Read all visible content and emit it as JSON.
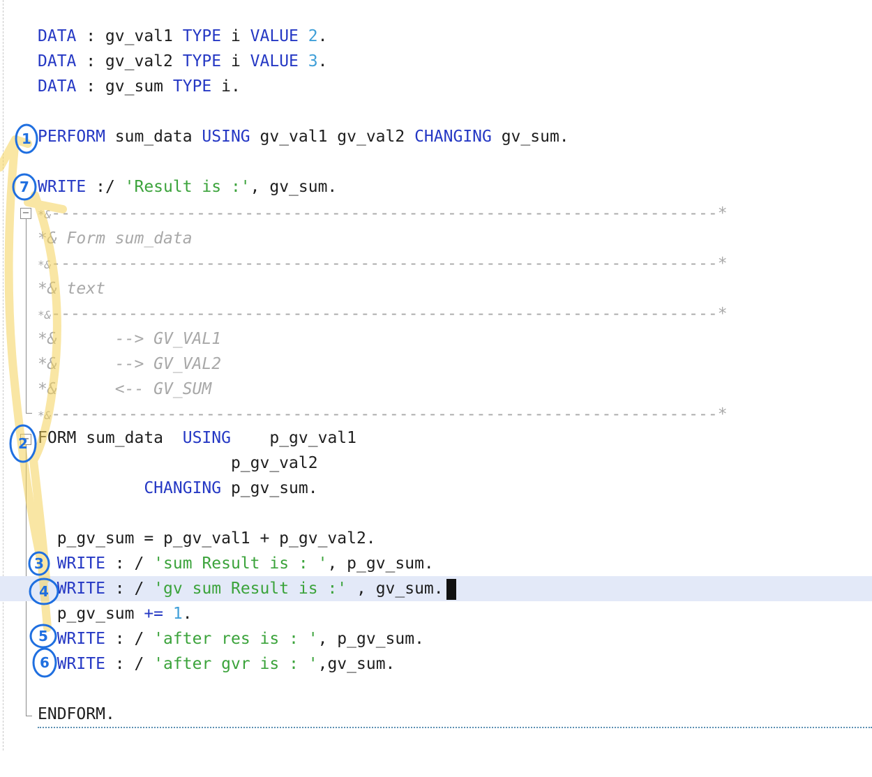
{
  "code": {
    "l1": {
      "kw1": "DATA",
      "p1": " : gv_val1 ",
      "kw2": "TYPE",
      "p2": " i ",
      "kw3": "VALUE",
      "sp": " ",
      "num": "2",
      "end": "."
    },
    "l2": {
      "kw1": "DATA",
      "p1": " : gv_val2 ",
      "kw2": "TYPE",
      "p2": " i ",
      "kw3": "VALUE",
      "sp": " ",
      "num": "3",
      "end": "."
    },
    "l3": {
      "kw1": "DATA",
      "p1": " : gv_sum ",
      "kw2": "TYPE",
      "p2": " i."
    },
    "l4": {
      "kw1": "PERFORM",
      "p1": " sum_data ",
      "kw2": "USING",
      "p2": " gv_val1 gv_val2 ",
      "kw3": "CHANGING",
      "p3": " gv_sum."
    },
    "l5": {
      "kw1": "WRITE",
      "p1": " :/ ",
      "str": "'Result is :'",
      "p2": ", gv_sum."
    },
    "c1": {
      "star": "*&",
      "dashes": "---------------------------------------------------------------------*"
    },
    "c2": {
      "text": "*& Form sum_data"
    },
    "c3": {
      "star": "*&",
      "dashes": "---------------------------------------------------------------------*"
    },
    "c4": {
      "text": "*& text"
    },
    "c5": {
      "star": "*&",
      "dashes": "---------------------------------------------------------------------*"
    },
    "c6": {
      "text": "*&      --> GV_VAL1"
    },
    "c7": {
      "text": "*&      --> GV_VAL2"
    },
    "c8": {
      "text": "*&      <-- GV_SUM"
    },
    "c9": {
      "star": "*&",
      "dashes": "---------------------------------------------------------------------*"
    },
    "l6": {
      "kw1": "FORM",
      "p1": " sum_data  ",
      "kw2": "USING",
      "p2": "    p_gv_val1"
    },
    "l7": {
      "p1": "                    p_gv_val2"
    },
    "l8": {
      "indent": "           ",
      "kw1": "CHANGING",
      "p1": " p_gv_sum."
    },
    "l9": {
      "p1": "  p_gv_sum = p_gv_val1 + p_gv_val2."
    },
    "l10": {
      "indent": "  ",
      "kw1": "WRITE",
      "p1": " : / ",
      "str": "'sum Result is : '",
      "p2": ", p_gv_sum."
    },
    "l11": {
      "indent": "  ",
      "kw1": "WRITE",
      "p1": " : / ",
      "str": "'gv sum Result is :'",
      "p2": " , gv_sum."
    },
    "l12": {
      "indent": "  ",
      "p1": "p_gv_sum ",
      "kw1": "+=",
      "sp": " ",
      "num": "1",
      "end": "."
    },
    "l13": {
      "indent": "  ",
      "kw1": "WRITE",
      "p1": " : / ",
      "str": "'after res is : '",
      "p2": ", p_gv_sum."
    },
    "l14": {
      "indent": "  ",
      "kw1": "WRITE",
      "p1": " : / ",
      "str": "'after gvr is : '",
      "p2": ",gv_sum."
    },
    "l15": {
      "kw1": "ENDFORM",
      "end": "."
    }
  },
  "annotations": {
    "marker_color": "#f5d35a",
    "circle_color": "#1f6fe0",
    "labels": [
      "1",
      "7",
      "2",
      "3",
      "4",
      "5",
      "6"
    ]
  }
}
